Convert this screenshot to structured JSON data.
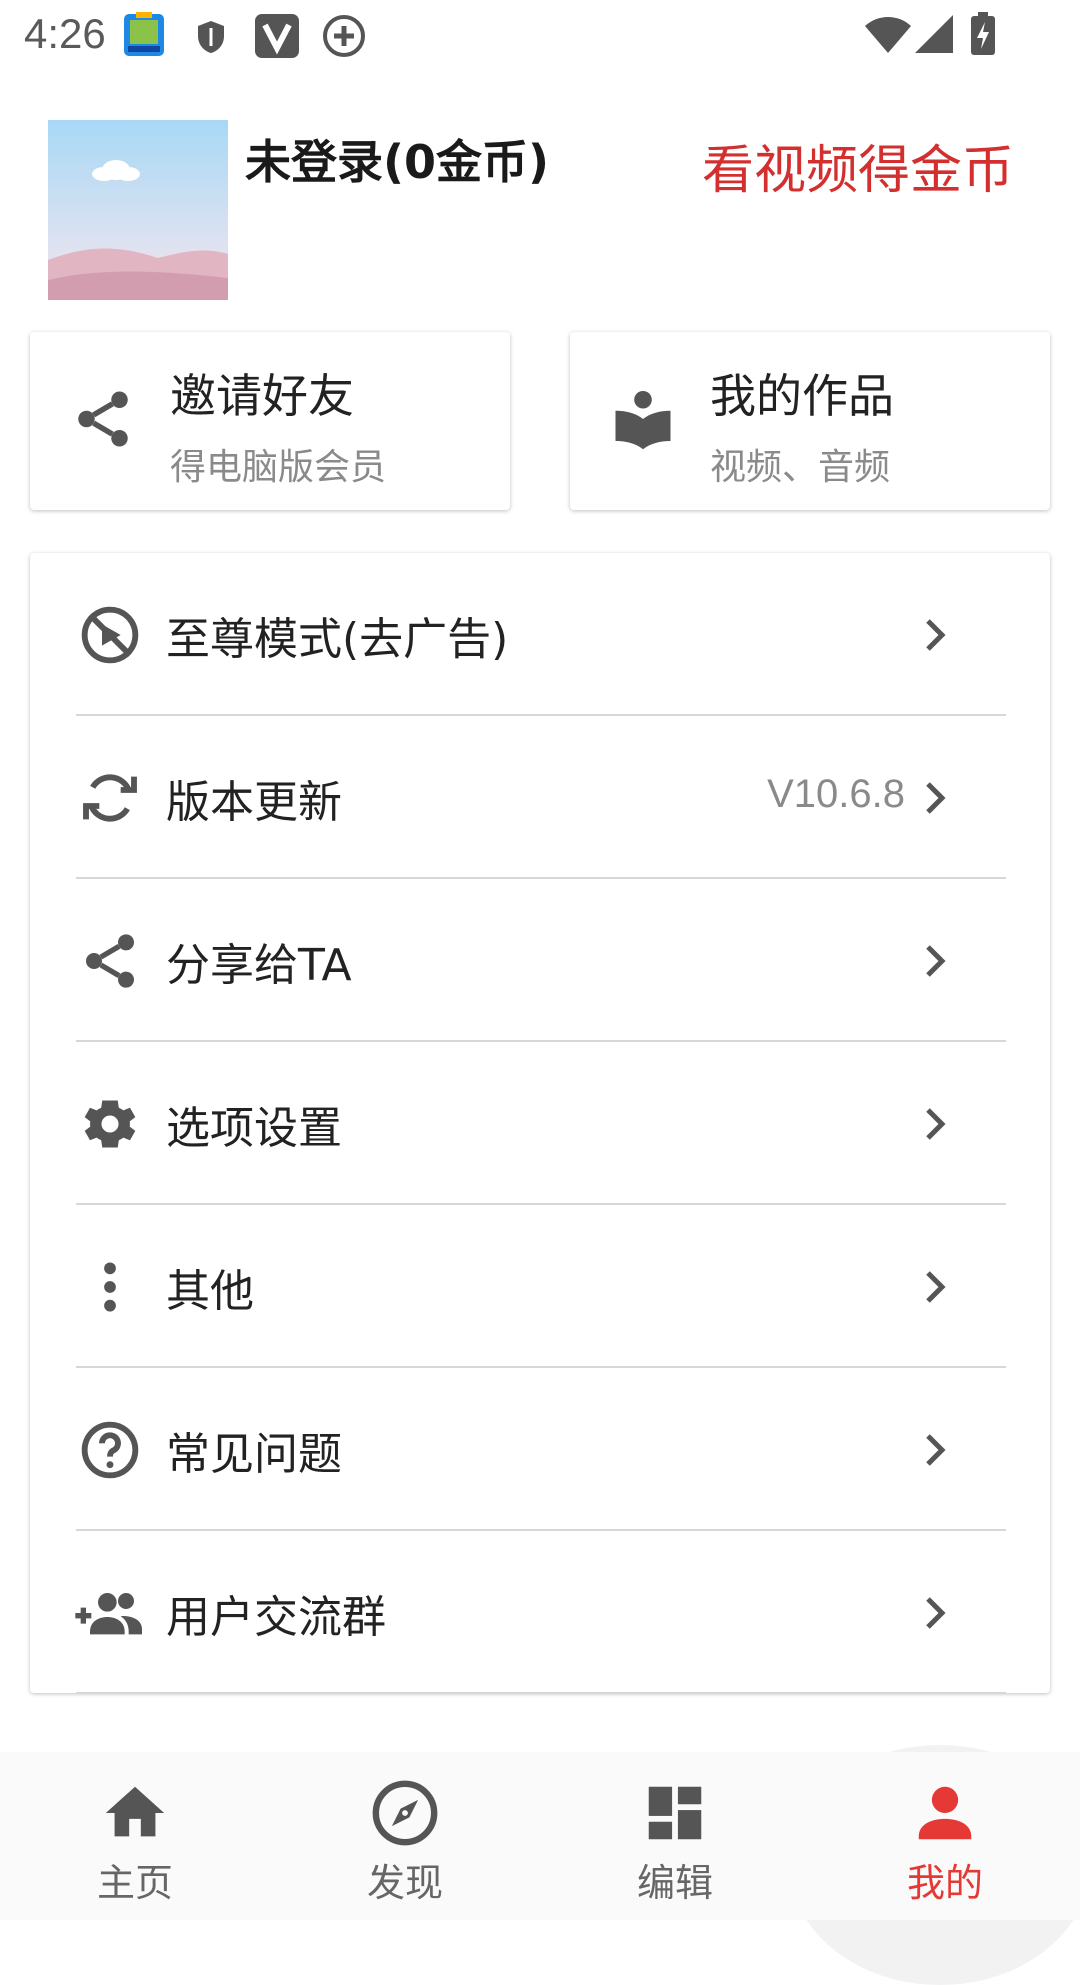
{
  "status_bar": {
    "time": "4:26",
    "icons": [
      "app-calendar-icon",
      "shield-icon",
      "v-app-icon",
      "add-circle-icon",
      "wifi-icon",
      "signal-icon",
      "battery-charging-icon"
    ]
  },
  "profile": {
    "username": "未登录(0金币)",
    "earn_link": "看视频得金币"
  },
  "cards": [
    {
      "title": "邀请好友",
      "subtitle": "得电脑版会员",
      "icon": "share-icon"
    },
    {
      "title": "我的作品",
      "subtitle": "视频、音频",
      "icon": "book-icon"
    }
  ],
  "menu": [
    {
      "label": "至尊模式(去广告)",
      "icon": "no-ads-icon",
      "value": ""
    },
    {
      "label": "版本更新",
      "icon": "sync-icon",
      "value": "V10.6.8"
    },
    {
      "label": "分享给TA",
      "icon": "share-icon",
      "value": ""
    },
    {
      "label": "选项设置",
      "icon": "gear-icon",
      "value": ""
    },
    {
      "label": "其他",
      "icon": "more-vertical-icon",
      "value": ""
    },
    {
      "label": "常见问题",
      "icon": "help-icon",
      "value": ""
    },
    {
      "label": "用户交流群",
      "icon": "group-add-icon",
      "value": ""
    }
  ],
  "bottom_nav": [
    {
      "label": "主页",
      "icon": "home-icon",
      "active": false
    },
    {
      "label": "发现",
      "icon": "compass-icon",
      "active": false
    },
    {
      "label": "编辑",
      "icon": "dashboard-icon",
      "active": false
    },
    {
      "label": "我的",
      "icon": "person-icon",
      "active": true
    }
  ],
  "colors": {
    "accent": "#e53935",
    "earn_link": "#d32f2f",
    "icon_gray": "#555555",
    "subtitle_gray": "#8a8a8a"
  }
}
